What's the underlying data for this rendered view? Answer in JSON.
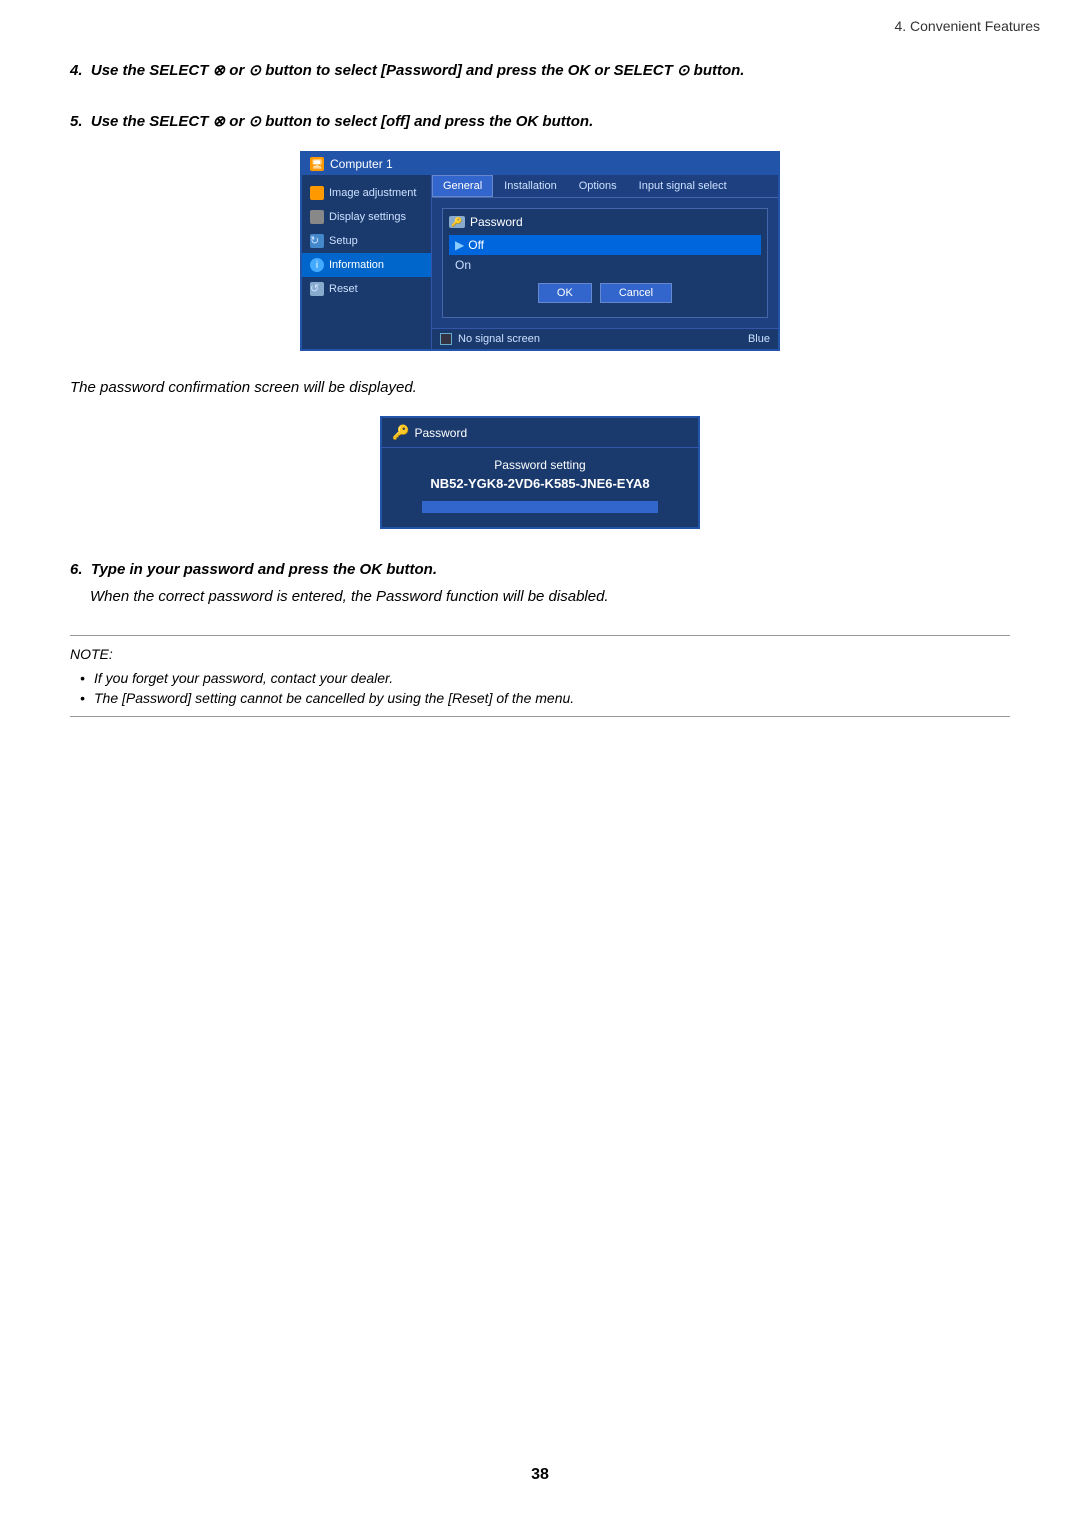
{
  "header": {
    "title": "4. Convenient Features"
  },
  "steps": {
    "step4": {
      "number": "4.",
      "text": "Use the SELECT ⊗ or ⊙ button to select [Password] and press the OK or SELECT ⊙ button."
    },
    "step5": {
      "number": "5.",
      "text": "Use the SELECT ⊗ or ⊙ button to select [off] and press the OK button."
    },
    "step6": {
      "number": "6.",
      "text": "Type in your password and press the OK button.",
      "subtext": "When the correct password is entered, the Password function will be disabled."
    }
  },
  "ui1": {
    "titlebar": "Computer 1",
    "sidebar": {
      "items": [
        {
          "label": "Image adjustment",
          "iconType": "orange"
        },
        {
          "label": "Display settings",
          "iconType": "gray"
        },
        {
          "label": "Setup",
          "iconType": "blue"
        },
        {
          "label": "Information",
          "iconType": "info"
        },
        {
          "label": "Reset",
          "iconType": "reset"
        }
      ]
    },
    "tabs": [
      "General",
      "Installation",
      "Options",
      "Input signal select"
    ],
    "dialog": {
      "title": "Password",
      "options": [
        {
          "label": "Off",
          "selected": true
        },
        {
          "label": "On",
          "selected": false
        }
      ],
      "buttons": {
        "ok": "OK",
        "cancel": "Cancel"
      }
    },
    "bottomBar": {
      "label": "No signal screen",
      "value": "Blue"
    }
  },
  "passwordDialog": {
    "title": "Password",
    "settingLabel": "Password setting",
    "settingValue": "NB52-YGK8-2VD6-K585-JNE6-EYA8"
  },
  "confirmText": "The password confirmation screen will be displayed.",
  "note": {
    "label": "NOTE:",
    "items": [
      "If you forget your password, contact your dealer.",
      "The [Password] setting cannot be cancelled by using the [Reset] of the menu."
    ]
  },
  "pageNumber": "38"
}
